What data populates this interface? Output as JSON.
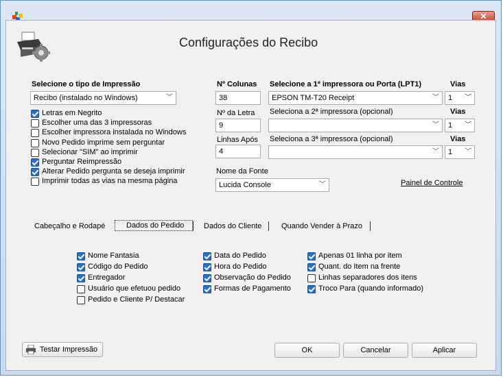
{
  "window": {
    "title": "Configurações do Recibo",
    "close_symbol": "✕"
  },
  "print_type": {
    "label": "Selecione o tipo de Impressão",
    "selected": "Recibo (instalado no Windows)"
  },
  "options": [
    {
      "label": "Letras em Negrito",
      "checked": true
    },
    {
      "label": "Escolher uma das 3 impressoras",
      "checked": false
    },
    {
      "label": "Escolher impressora instalada no Windows",
      "checked": false
    },
    {
      "label": "Novo Pedido imprime sem perguntar",
      "checked": false
    },
    {
      "label": "Selecionar \"SIM\" ao imprimir",
      "checked": false
    },
    {
      "label": "Perguntar Reimpressão",
      "checked": true
    },
    {
      "label": "Alterar Pedido pergunta se deseja imprimir",
      "checked": true
    },
    {
      "label": "Imprimir todas as vias na mesma página",
      "checked": false
    }
  ],
  "columns": {
    "label": "Nº Colunas",
    "value": "38"
  },
  "font_size": {
    "label": "Nº da Letra",
    "value": "9"
  },
  "lines_after": {
    "label": "Linhas Após",
    "value": "4"
  },
  "printer1": {
    "label": "Selecione a 1ª impressora ou Porta (LPT1)",
    "selected": "EPSON TM-T20 Receipt"
  },
  "printer2": {
    "label": "Seleciona a 2ª impressora (opcional)",
    "selected": ""
  },
  "printer3": {
    "label": "Seleciona a 3ª impressora (opcional)",
    "selected": ""
  },
  "vias_label": "Vias",
  "vias": [
    "1",
    "1",
    "1"
  ],
  "font_name": {
    "label": "Nome da Fonte",
    "selected": "Lucida Console"
  },
  "control_panel_link": "Painel de Controle",
  "tabs": [
    {
      "label": "Cabeçalho e Rodapé",
      "active": false
    },
    {
      "label": "Dados do Pedido",
      "active": true
    },
    {
      "label": "Dados do Cliente",
      "active": false
    },
    {
      "label": "Quando Vender à Prazo",
      "active": false
    }
  ],
  "order_fields": {
    "col1": [
      {
        "label": "Nome Fantasia",
        "checked": true
      },
      {
        "label": "Código do Pedido",
        "checked": true
      },
      {
        "label": "Entregador",
        "checked": true
      },
      {
        "label": "Usuário que efetuou pedido",
        "checked": false
      },
      {
        "label": "Pedido e Cliente P/ Destacar",
        "checked": false
      }
    ],
    "col2": [
      {
        "label": "Data do Pedido",
        "checked": true
      },
      {
        "label": "Hora do Pedido",
        "checked": true
      },
      {
        "label": "Observação do Pedido",
        "checked": true
      },
      {
        "label": "Formas de Pagamento",
        "checked": true
      }
    ],
    "col3": [
      {
        "label": "Apenas 01 linha por item",
        "checked": true
      },
      {
        "label": "Quant. do Item na frente",
        "checked": true
      },
      {
        "label": "Linhas separadores dos itens",
        "checked": false
      },
      {
        "label": "Troco Para (quando informado)",
        "checked": true
      }
    ]
  },
  "buttons": {
    "test_print": "Testar Impressão",
    "ok": "OK",
    "cancel": "Cancelar",
    "apply": "Aplicar"
  },
  "colors": {
    "accent": "#2a6fc6",
    "close": "#c4402c"
  }
}
